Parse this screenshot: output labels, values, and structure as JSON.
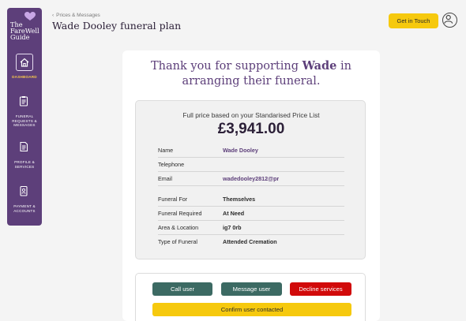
{
  "sidebar": {
    "logo_text": [
      "The",
      "FareWell",
      "Guide"
    ],
    "items": [
      {
        "label": "DASHBOARD",
        "icon": "home-icon"
      },
      {
        "label": "FUNERAL REQUESTS & MESSAGES",
        "icon": "clipboard-icon"
      },
      {
        "label": "PROFILE & SERVICES",
        "icon": "document-icon"
      },
      {
        "label": "PAYMENT & ACCOUNTS",
        "icon": "id-card-icon"
      }
    ],
    "accent": "#f6c84a",
    "bg": "#5d3f7a"
  },
  "header": {
    "breadcrumb": "Prices & Messages",
    "title": "Wade Dooley funeral plan",
    "get_in_touch": "Get in Touch"
  },
  "card": {
    "thank_prefix": "Thank you for supporting",
    "thank_name": "Wade",
    "thank_suffix": "in",
    "thank_line2": "arranging their funeral.",
    "summary": {
      "price_label": "Full price based on your Standarised Price List",
      "price": "£3,941.00",
      "contact": [
        {
          "key": "Name",
          "value": "Wade Dooley"
        },
        {
          "key": "Telephone",
          "value": ""
        },
        {
          "key": "Email",
          "value": "wadedooley2812@pr"
        }
      ],
      "details": [
        {
          "key": "Funeral For",
          "value": "Themselves"
        },
        {
          "key": "Funeral Required",
          "value": "At Need"
        },
        {
          "key": "Area & Location",
          "value": "ig7 0rb"
        },
        {
          "key": "Type of Funeral",
          "value": "Attended Cremation"
        }
      ]
    },
    "actions": {
      "call": "Call user",
      "message": "Message user",
      "decline": "Decline services",
      "confirm": "Confirm user contacted"
    }
  },
  "colors": {
    "brand_purple": "#5d3f7a",
    "yellow": "#f6c90e",
    "teal": "#3c6a63",
    "red": "#d10a0a"
  }
}
